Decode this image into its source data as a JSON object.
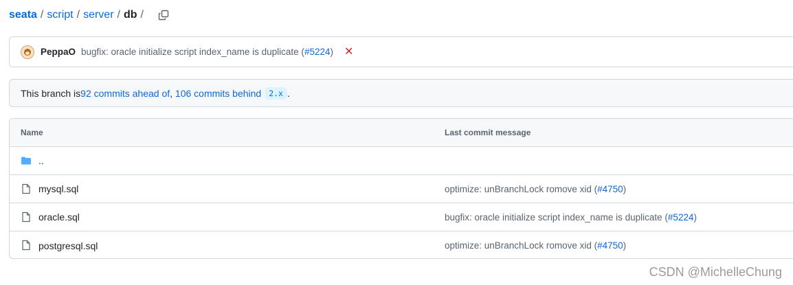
{
  "breadcrumb": {
    "repo": "seata",
    "parts": [
      "script",
      "server"
    ],
    "current": "db",
    "separator": "/"
  },
  "latest_commit": {
    "author": "PeppaO",
    "message_prefix": "bugfix: oracle initialize script index_name is duplicate (",
    "pr": "#5224",
    "message_suffix": ")",
    "status_icon": "x-icon",
    "status_color": "#cf222e"
  },
  "branch_info": {
    "prefix": "This branch is ",
    "ahead": "92 commits ahead of",
    "comma": ", ",
    "behind": "106 commits behind",
    "base": "2.x",
    "suffix": "."
  },
  "table": {
    "col_name": "Name",
    "col_msg": "Last commit message",
    "parent_dir": "..",
    "files": [
      {
        "name": "mysql.sql",
        "msg_prefix": "optimize: unBranchLock romove xid (",
        "pr": "#4750",
        "msg_suffix": ")"
      },
      {
        "name": "oracle.sql",
        "msg_prefix": "bugfix: oracle initialize script index_name is duplicate (",
        "pr": "#5224",
        "msg_suffix": ")"
      },
      {
        "name": "postgresql.sql",
        "msg_prefix": "optimize: unBranchLock romove xid (",
        "pr": "#4750",
        "msg_suffix": ")"
      }
    ]
  },
  "watermark": "CSDN @MichelleChung",
  "colors": {
    "link": "#0969da",
    "folder": "#54aeff",
    "border": "#d0d7de"
  }
}
